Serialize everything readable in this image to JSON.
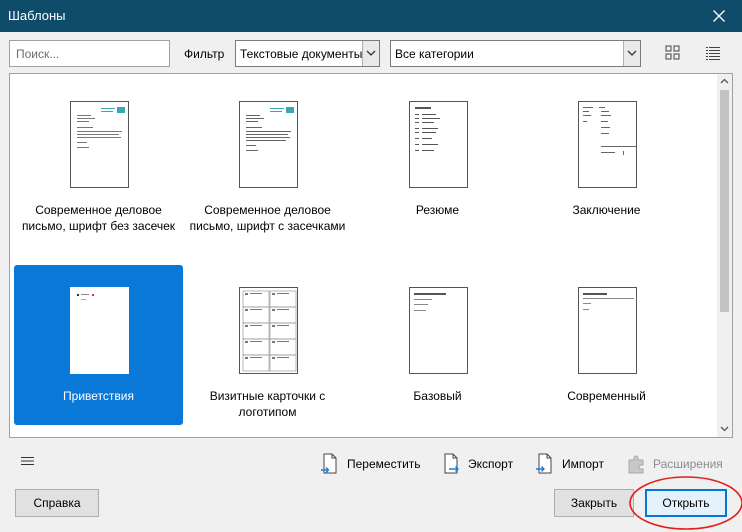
{
  "window": {
    "title": "Шаблоны"
  },
  "toolbar": {
    "search_placeholder": "Поиск...",
    "filter_label": "Фильтр",
    "filter_selected": "Текстовые документы",
    "category_selected": "Все категории"
  },
  "templates": [
    {
      "label": "Современное деловое письмо, шрифт без засечек",
      "selected": false
    },
    {
      "label": "Современное деловое письмо, шрифт с засечками",
      "selected": false
    },
    {
      "label": "Резюме",
      "selected": false
    },
    {
      "label": "Заключение",
      "selected": false
    },
    {
      "label": "Приветствия",
      "selected": true
    },
    {
      "label": "Визитные карточки с логотипом",
      "selected": false
    },
    {
      "label": "Базовый",
      "selected": false
    },
    {
      "label": "Современный",
      "selected": false
    }
  ],
  "actions": {
    "move": "Переместить",
    "export": "Экспорт",
    "import": "Импорт",
    "extensions": "Расширения"
  },
  "buttons": {
    "help": "Справка",
    "close": "Закрыть",
    "open": "Открыть"
  },
  "colors": {
    "titlebar": "#0f4c6a",
    "selection": "#0a78d7",
    "accent": "#0078d7",
    "annotation": "#e0201d"
  }
}
